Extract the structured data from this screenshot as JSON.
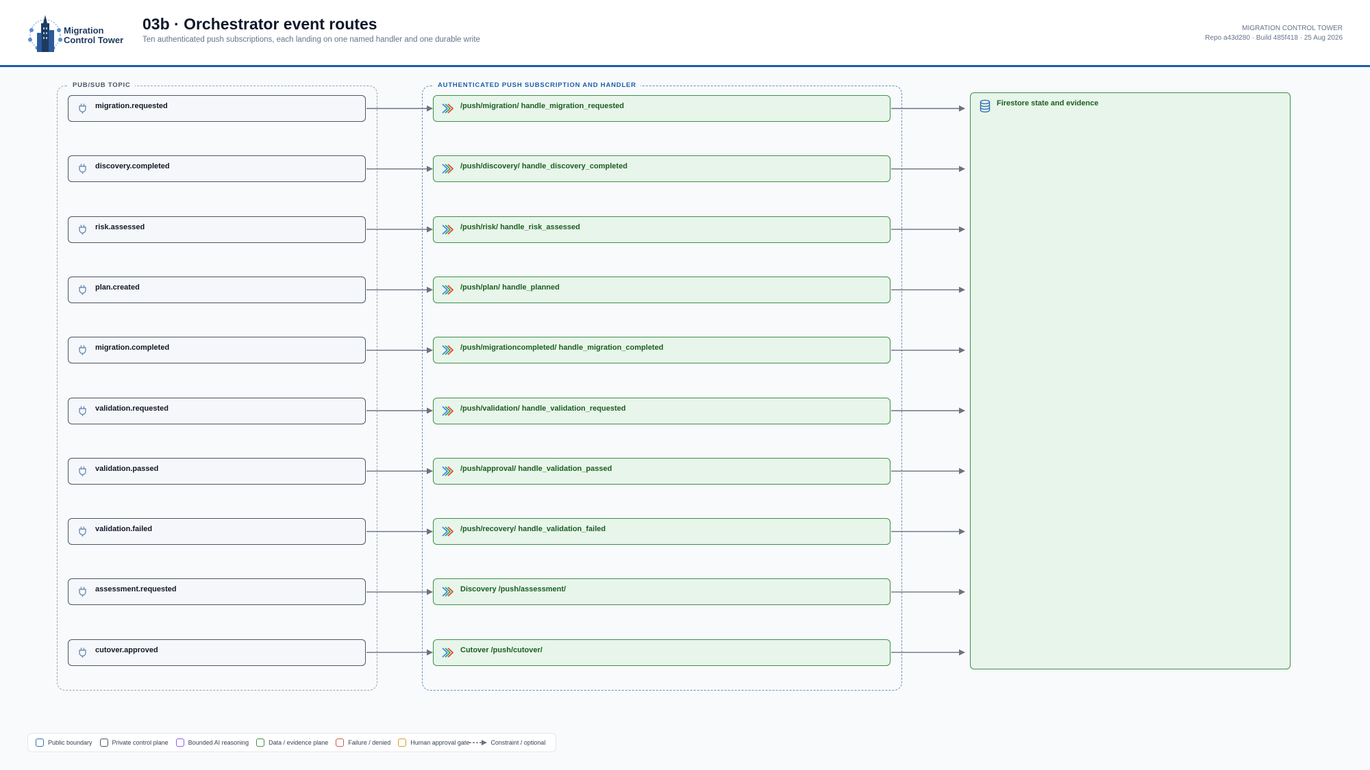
{
  "header": {
    "logo_line1": "Migration",
    "logo_line2": "Control Tower",
    "title": "03b · Orchestrator event routes",
    "subtitle": "Ten authenticated push subscriptions, each landing on one named handler and one durable write",
    "meta_line1": "MIGRATION CONTROL TOWER",
    "meta_line2": "Repo a43d280 · Build 485f418 · 25 Aug 2026"
  },
  "groups": {
    "topics_label": "PUB/SUB TOPIC",
    "subscriptions_label": "AUTHENTICATED PUSH SUBSCRIPTION AND HANDLER"
  },
  "topics": [
    "migration.requested",
    "discovery.completed",
    "risk.assessed",
    "plan.created",
    "migration.completed",
    "validation.requested",
    "validation.passed",
    "validation.failed",
    "assessment.requested",
    "cutover.approved"
  ],
  "handlers": [
    "/push/migration/ handle_migration_requested",
    "/push/discovery/ handle_discovery_completed",
    "/push/risk/ handle_risk_assessed",
    "/push/plan/ handle_planned",
    "/push/migrationcompleted/ handle_migration_completed",
    "/push/validation/ handle_validation_requested",
    "/push/approval/ handle_validation_passed",
    "/push/recovery/ handle_validation_failed",
    "Discovery /push/assessment/",
    "Cutover /push/cutover/"
  ],
  "store": {
    "label": "Firestore state and evidence"
  },
  "icons": {
    "topic": "pubsub-plug-icon",
    "handler": "cloud-run-icon",
    "store": "database-icon",
    "logo": "control-tower-logo"
  },
  "legend": [
    {
      "label": "Public boundary",
      "color": "#2f6fb8"
    },
    {
      "label": "Private control plane",
      "color": "#4b5563"
    },
    {
      "label": "Bounded AI reasoning",
      "color": "#8b5cf6"
    },
    {
      "label": "Data / evidence plane",
      "color": "#3f8f4a"
    },
    {
      "label": "Failure / denied",
      "color": "#d9534f"
    },
    {
      "label": "Human approval gate",
      "color": "#d99a2b"
    }
  ],
  "legend_constraint": "Constraint / optional",
  "colors": {
    "accent": "#1d5fa8",
    "topic_border": "#4b5563",
    "handler_border": "#3f8f4a",
    "handler_fill": "#e8f5ea",
    "edge": "#6b7280"
  }
}
